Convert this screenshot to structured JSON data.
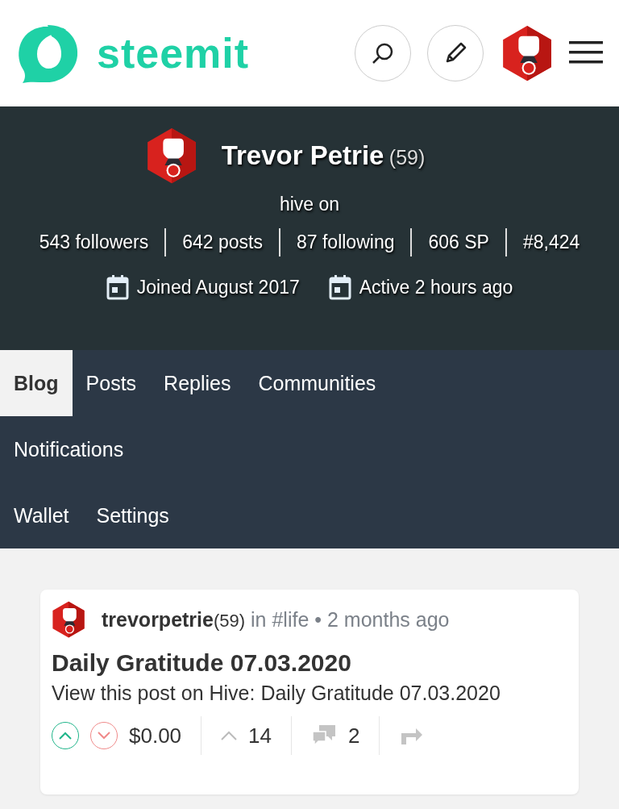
{
  "header": {
    "logo_text": "steemit"
  },
  "profile": {
    "name": "Trevor Petrie",
    "reputation": "(59)",
    "about": "hive on",
    "stats": [
      "543 followers",
      "642 posts",
      "87 following",
      "606 SP",
      "#8,424"
    ],
    "dates": [
      "Joined August 2017",
      "Active 2 hours ago"
    ]
  },
  "tab_rows": [
    [
      {
        "label": "Blog",
        "selected": true
      },
      {
        "label": "Posts",
        "selected": false
      },
      {
        "label": "Replies",
        "selected": false
      },
      {
        "label": "Communities",
        "selected": false
      }
    ],
    [
      {
        "label": "Notifications",
        "selected": false
      }
    ],
    [
      {
        "label": "Wallet",
        "selected": false
      },
      {
        "label": "Settings",
        "selected": false
      }
    ]
  ],
  "posts": [
    {
      "author": "trevorpetrie",
      "reputation": "(59)",
      "category": "in #life",
      "separator": "•",
      "time": "2 months ago",
      "title": "Daily Gratitude 07.03.2020",
      "summary": "View this post on Hive: Daily Gratitude 07.03.2020",
      "payout": "$0.00",
      "votes": "14",
      "comments": "2"
    }
  ]
}
